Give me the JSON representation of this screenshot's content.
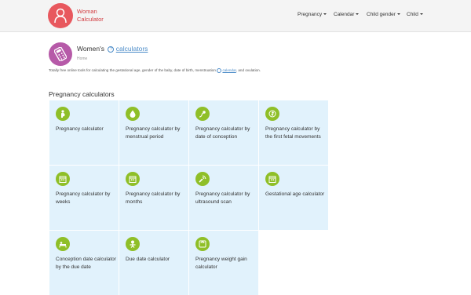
{
  "header": {
    "brand_line1": "Woman",
    "brand_line2": "Calculator",
    "nav": [
      {
        "label": "Pregnancy"
      },
      {
        "label": "Calendar"
      },
      {
        "label": "Child gender"
      },
      {
        "label": "Child"
      }
    ]
  },
  "page": {
    "title_prefix": "Women's",
    "title_link": "calculators",
    "breadcrumb": "Home",
    "description_part1": "Totally free online tools for calculating the gestational age, gender of the baby, date of birth, menstruation",
    "description_link": "calendar",
    "description_part2": ", and ovulation."
  },
  "section_title": "Pregnancy calculators",
  "calculators": [
    {
      "label": "Pregnancy calculator",
      "icon": "pregnant-icon"
    },
    {
      "label": "Pregnancy calculator by menstrual period",
      "icon": "drop-icon"
    },
    {
      "label": "Pregnancy calculator by date of conception",
      "icon": "sperm-icon"
    },
    {
      "label": "Pregnancy calculator by the first fetal movements",
      "icon": "fetus-icon"
    },
    {
      "label": "Pregnancy calculator by weeks",
      "icon": "calendar-icon"
    },
    {
      "label": "Pregnancy calculator by months",
      "icon": "calendar-icon"
    },
    {
      "label": "Pregnancy calculator by ultrasound scan",
      "icon": "ultrasound-icon"
    },
    {
      "label": "Gestational age calculator",
      "icon": "calendar-icon"
    },
    {
      "label": "Conception date calculator by the due date",
      "icon": "bed-icon"
    },
    {
      "label": "Due date calculator",
      "icon": "baby-icon"
    },
    {
      "label": "Pregnancy weight gain calculator",
      "icon": "scale-icon"
    }
  ],
  "colors": {
    "logo_bg": "#e8585e",
    "page_icon_bg": "#b65aa8",
    "tile_bg": "#e1f2fc",
    "tile_icon_bg": "#8fbf28",
    "link": "#4a8bc8"
  }
}
